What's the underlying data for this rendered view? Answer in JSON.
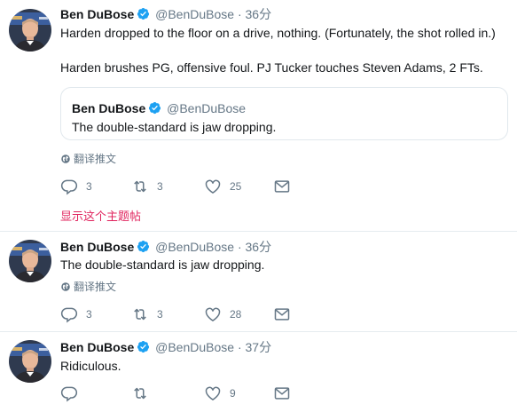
{
  "tweets": [
    {
      "name": "Ben DuBose",
      "handle": "@BenDuBose",
      "time": "36分",
      "text_lines": [
        "Harden dropped to the floor on a drive, nothing. (Fortunately, the shot rolled in.)",
        "Harden brushes PG, offensive foul. PJ Tucker touches Steven Adams, 2 FTs."
      ],
      "quote": {
        "name": "Ben DuBose",
        "handle": "@BenDuBose",
        "text": "The double-standard is jaw dropping."
      },
      "translate": "翻译推文",
      "replies": "3",
      "retweets": "3",
      "likes": "25",
      "thread_link": "显示这个主题帖"
    },
    {
      "name": "Ben DuBose",
      "handle": "@BenDuBose",
      "time": "36分",
      "text": "The double-standard is jaw dropping.",
      "translate": "翻译推文",
      "replies": "3",
      "retweets": "3",
      "likes": "28"
    },
    {
      "name": "Ben DuBose",
      "handle": "@BenDuBose",
      "time": "37分",
      "text": "Ridiculous.",
      "replies": "",
      "retweets": "",
      "likes": "9"
    }
  ],
  "icons": {
    "verified": "verified-badge-icon",
    "reply": "reply-icon",
    "retweet": "retweet-icon",
    "like": "heart-icon",
    "message": "envelope-icon",
    "translate": "globe-icon"
  },
  "colors": {
    "verified": "#1da1f2",
    "link_red": "#e0245e",
    "muted": "#657786"
  }
}
